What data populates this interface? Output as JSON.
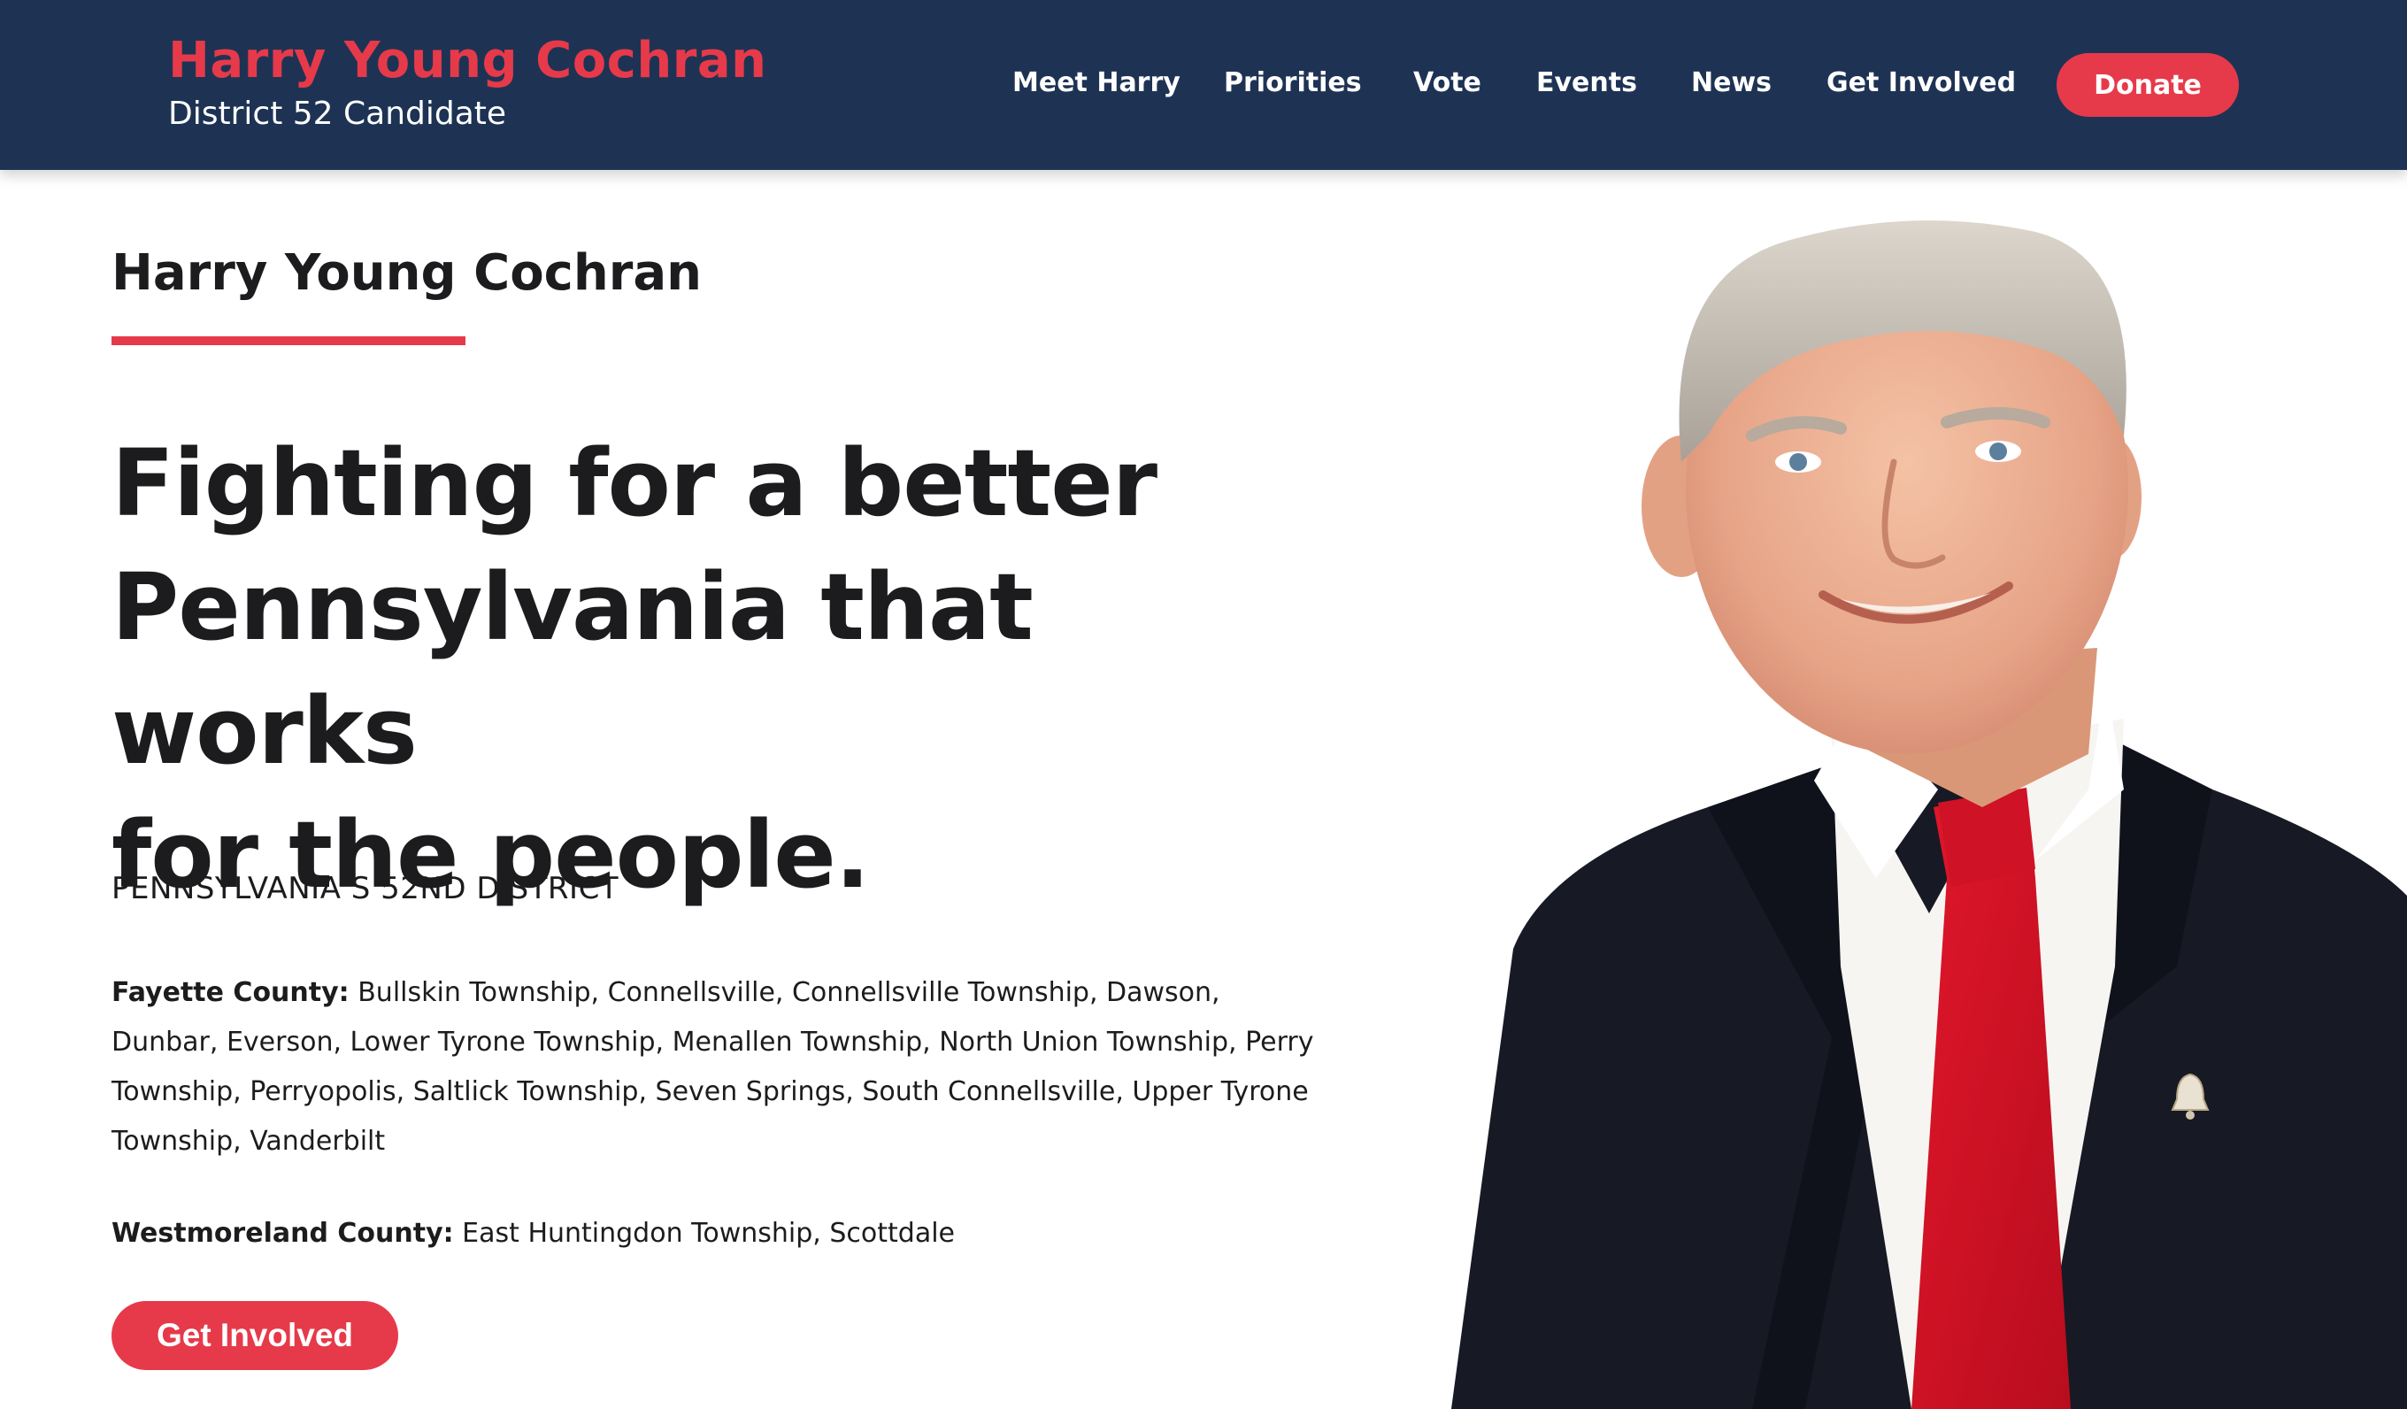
{
  "header": {
    "brand_name": "Harry Young Cochran",
    "brand_subtitle": "District 52 Candidate",
    "nav": {
      "meet": "Meet Harry",
      "priorities": "Priorities",
      "vote": "Vote",
      "events": "Events",
      "news": "News",
      "involved": "Get Involved"
    },
    "donate_label": "Donate"
  },
  "hero": {
    "kicker": "Harry Young Cochran",
    "headline_lines": [
      "Fighting for a better",
      "Pennsylvania that works",
      "for the people."
    ],
    "district_label": "PENNSYLVANIA’S 52ND DISTRICT",
    "counties": [
      {
        "name": "Fayette County:",
        "places": "Bullskin Township, Connellsville, Connellsville Township, Dawson, Dunbar, Everson, Lower Tyrone Township, Menallen Township, North Union Township, Perry Township, Perryopolis, Saltlick Township, Seven Springs, South Connellsville, Upper Tyrone Township, Vanderbilt"
      },
      {
        "name": "Westmoreland County:",
        "places": "East Huntingdon Township, Scottdale"
      }
    ],
    "cta_label": "Get Involved"
  },
  "colors": {
    "navy": "#1e3354",
    "accent_red": "#e63a4a",
    "text_dark": "#1c1c1e"
  },
  "icons": {
    "portrait": "candidate-portrait",
    "pin": "liberty-bell-pin-icon"
  }
}
